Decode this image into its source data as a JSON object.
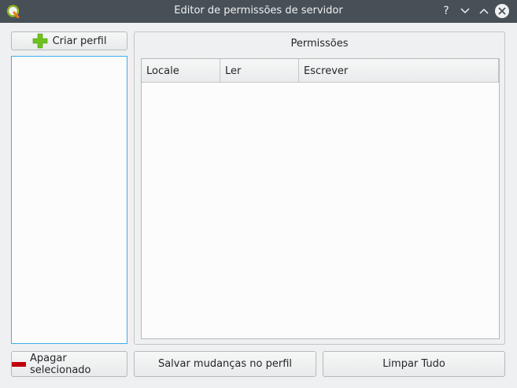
{
  "window": {
    "title": "Editor de permissões de servidor",
    "help_glyph": "?",
    "minimize_glyph": "⌄",
    "maximize_glyph": "⌃",
    "close_glyph": "✕"
  },
  "buttons": {
    "create_profile": "Criar perfil",
    "delete_selected": "Apagar selecionado",
    "save_changes": "Salvar mudanças no perfil",
    "clear_all": "Limpar Tudo"
  },
  "permissions": {
    "title": "Permissões",
    "columns": [
      "Locale",
      "Ler",
      "Escrever"
    ],
    "rows": []
  },
  "profiles": [],
  "colors": {
    "titlebar": "#475057",
    "accent": "#3daee9",
    "add_icon": "#6fc11f",
    "remove_icon": "#c0000a"
  },
  "icons": {
    "app": "qgis-icon",
    "add": "green-plus-icon",
    "remove": "red-minus-icon"
  }
}
